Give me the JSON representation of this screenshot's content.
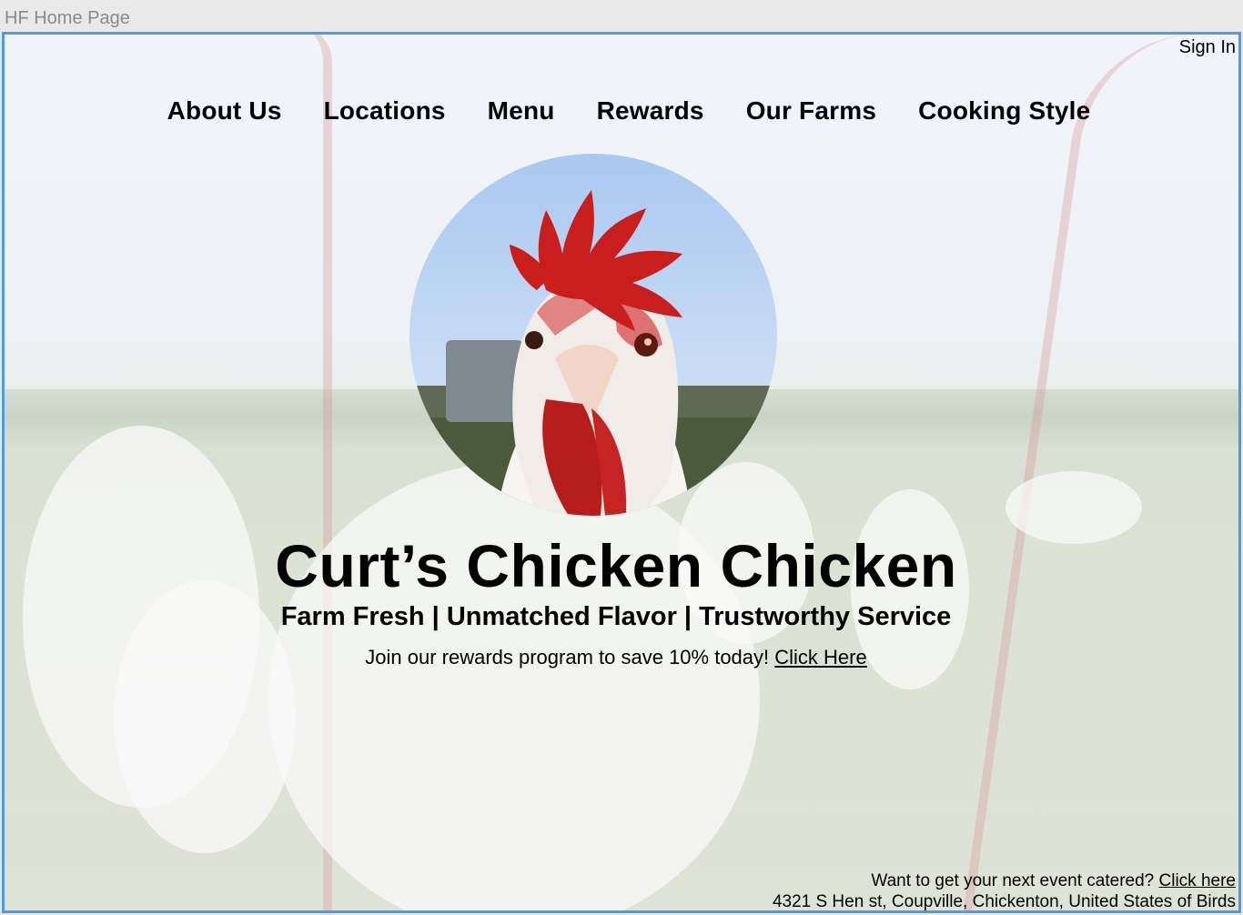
{
  "frame": {
    "title": "HF Home Page"
  },
  "header": {
    "sign_in_label": "Sign In"
  },
  "nav": {
    "items": [
      {
        "label": "About Us"
      },
      {
        "label": "Locations"
      },
      {
        "label": "Menu"
      },
      {
        "label": "Rewards"
      },
      {
        "label": "Our Farms"
      },
      {
        "label": "Cooking Style"
      }
    ]
  },
  "hero": {
    "image_icon": "rooster-portrait",
    "title": "Curt’s Chicken Chicken",
    "subtitle": "Farm Fresh | Unmatched Flavor | Trustworthy Service",
    "promo_text": "Join our rewards program to save 10% today! ",
    "promo_link": "Click Here"
  },
  "footer": {
    "catering_text": "Want to get your next event catered? ",
    "catering_link": "Click here",
    "address": "4321 S Hen st, Coupville, Chickenton, United States of Birds"
  },
  "colors": {
    "frame_border": "#4a9bea",
    "frame_title": "#8a8a8a",
    "comb_red": "#c81e1e"
  }
}
